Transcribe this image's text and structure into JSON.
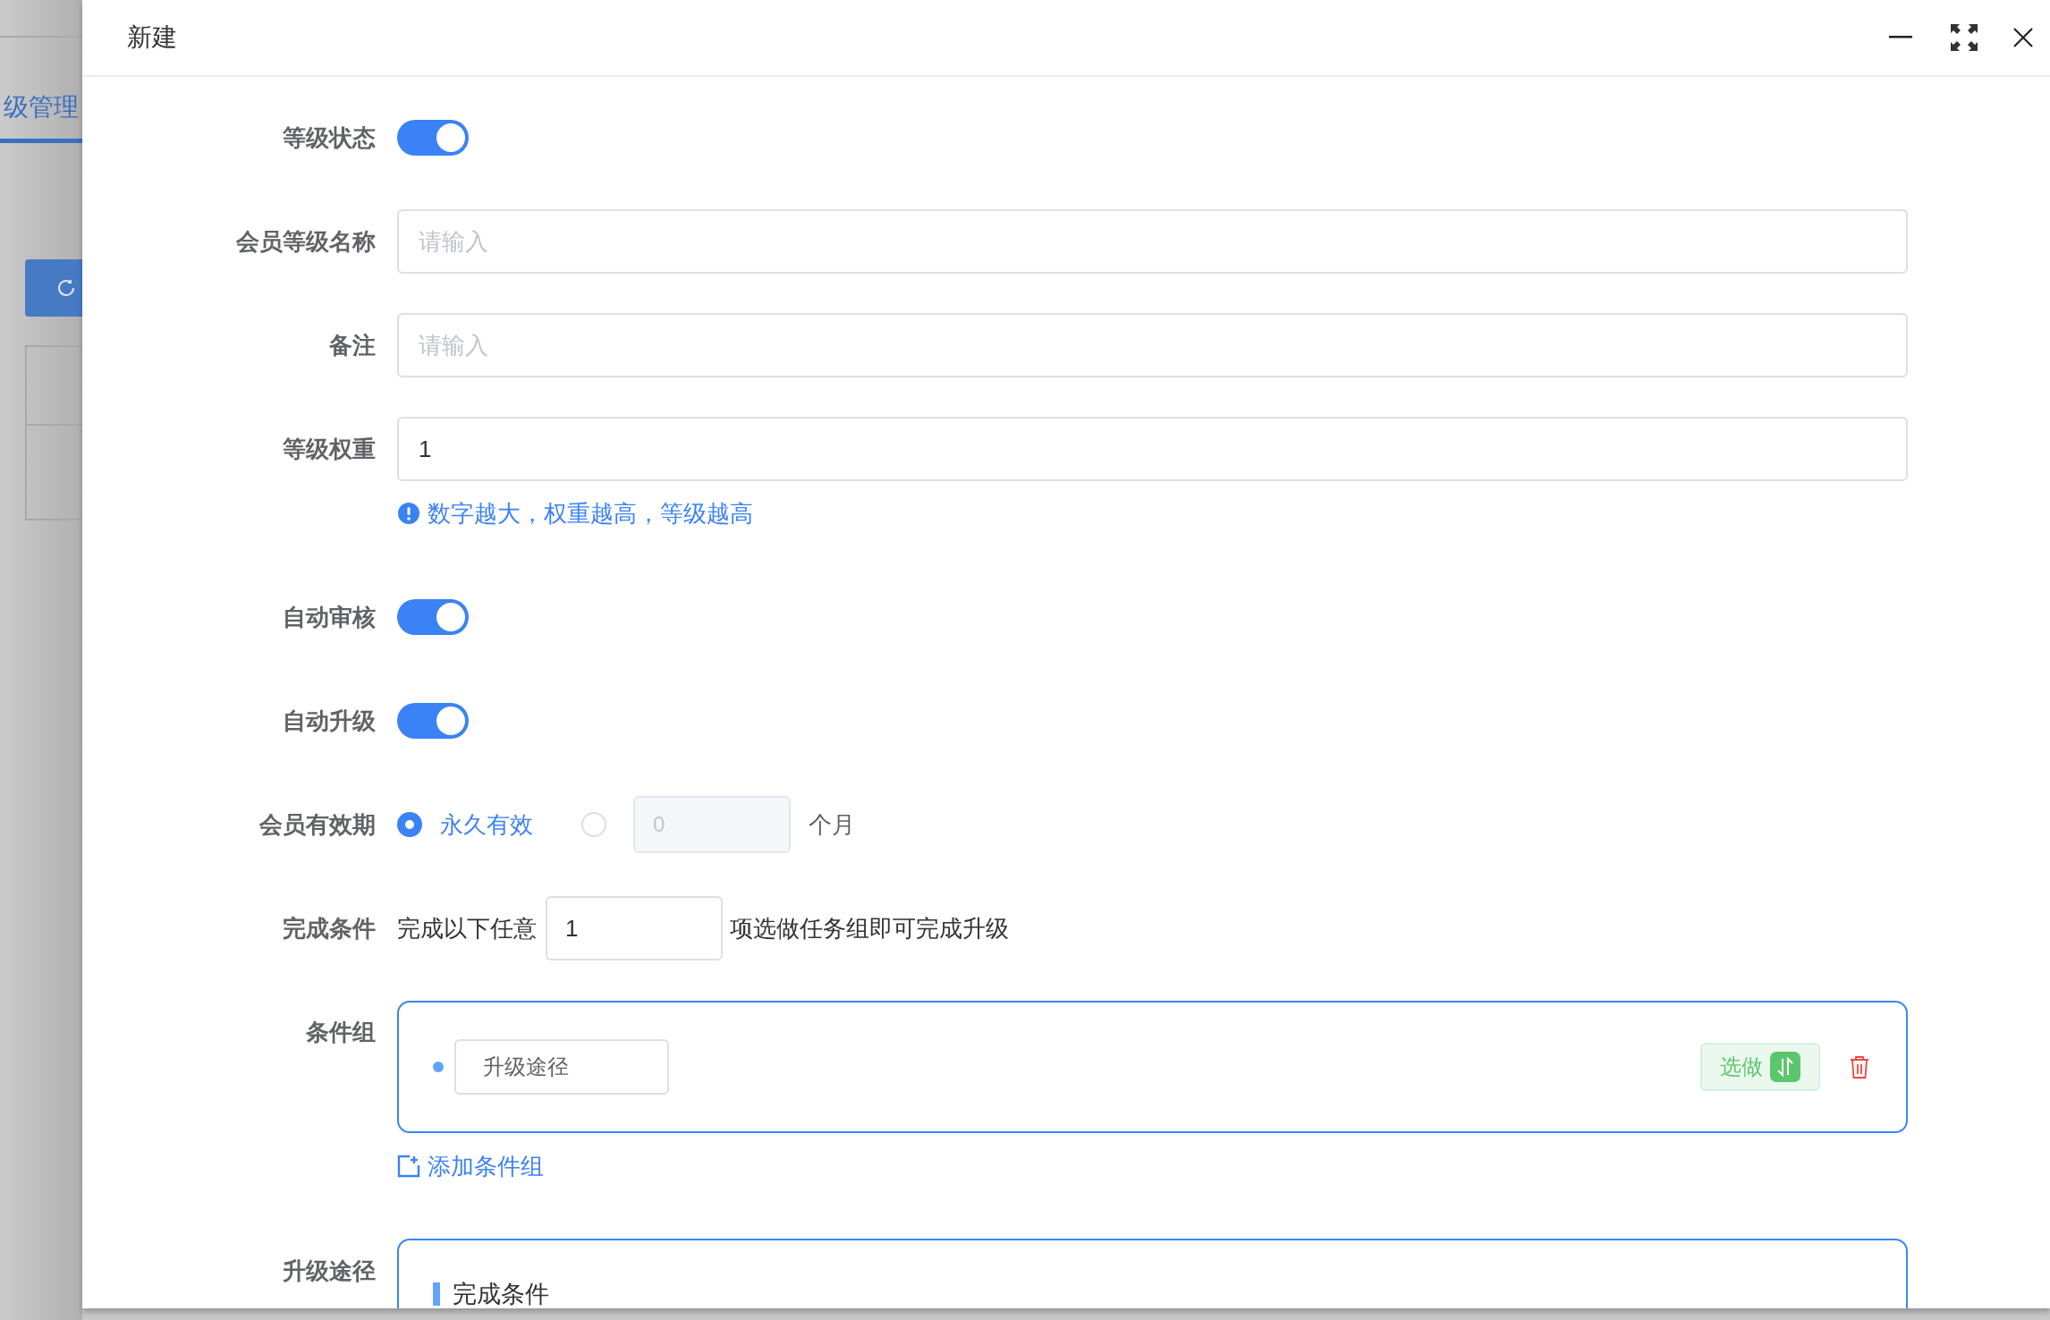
{
  "background": {
    "tab": "级管理"
  },
  "dialog": {
    "title": "新建"
  },
  "form": [
    {
      "kind": "switch",
      "label": "等级状态",
      "on": true
    },
    {
      "kind": "input",
      "label": "会员等级名称",
      "placeholder": "请输入"
    },
    {
      "kind": "input",
      "label": "备注",
      "placeholder": "请输入"
    },
    {
      "kind": "input",
      "label": "等级权重",
      "value": "1",
      "hint": "数字越大，权重越高，等级越高"
    },
    {
      "kind": "switch",
      "label": "自动审核",
      "on": true
    },
    {
      "kind": "switch",
      "label": "自动升级",
      "on": true
    },
    {
      "kind": "validity",
      "label": "会员有效期",
      "options": [
        {
          "label": "永久有效",
          "selected": true
        },
        {
          "value": "0",
          "unit": "个月",
          "selected": false,
          "disabled": true
        }
      ]
    },
    {
      "kind": "completion",
      "label": "完成条件",
      "prefix": "完成以下任意",
      "value": "1",
      "suffix": "项选做任务组即可完成升级"
    },
    {
      "kind": "groups",
      "label": "条件组",
      "groups": [
        {
          "name": "升级途径",
          "tag": "选做"
        }
      ],
      "add": "添加条件组"
    },
    {
      "kind": "path",
      "label": "升级途径",
      "section": "完成条件"
    }
  ]
}
